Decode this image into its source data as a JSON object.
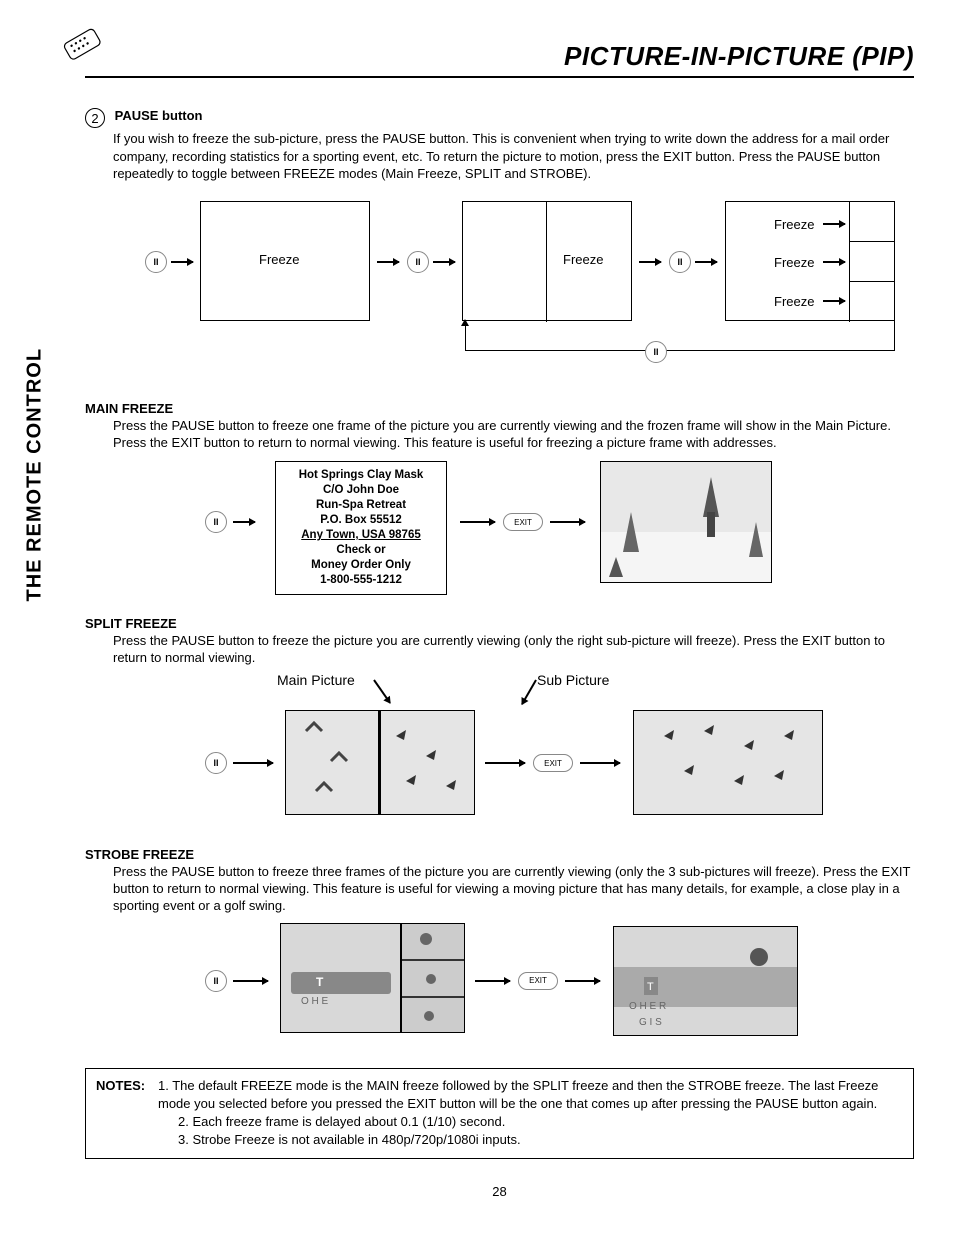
{
  "side_label": "THE REMOTE CONTROL",
  "page_title": "PICTURE-IN-PICTURE (PIP)",
  "step": {
    "num": "2",
    "heading": "PAUSE button",
    "body": "If you wish to freeze the sub-picture, press the PAUSE button. This is convenient when trying to write down the address for a mail order company, recording statistics for a sporting event, etc.  To return the picture to motion, press the EXIT button.  Press the PAUSE button repeatedly to toggle between FREEZE modes (Main Freeze, SPLIT and STROBE)."
  },
  "cycle_labels": {
    "freeze": "Freeze"
  },
  "main_freeze": {
    "heading": "MAIN FREEZE",
    "body": "Press the PAUSE button to freeze one frame of the picture you are currently viewing and the frozen frame will show in the Main Picture.  Press the EXIT button to return to normal viewing.  This feature is useful for freezing a picture frame with addresses.",
    "address_lines": [
      "Hot Springs Clay Mask",
      "C/O John Doe",
      "Run-Spa Retreat",
      "P.O. Box 55512",
      "Any Town, USA 98765",
      "Check or",
      "Money Order Only",
      "1-800-555-1212"
    ]
  },
  "split_freeze": {
    "heading": "SPLIT FREEZE",
    "body": "Press the PAUSE button to freeze the picture you are currently viewing (only the right sub-picture will freeze).  Press the EXIT button to return to normal viewing.",
    "label_main": "Main Picture",
    "label_sub": "Sub Picture"
  },
  "strobe_freeze": {
    "heading": "STROBE FREEZE",
    "body": "Press the PAUSE button to freeze three frames of the picture you are currently viewing (only the 3 sub-pictures will freeze). Press the EXIT button to return to normal viewing. This feature is useful for viewing a moving picture that has many details, for example, a close play in a sporting event or a golf swing."
  },
  "exit_label": "EXIT",
  "notes": {
    "label": "NOTES:",
    "items": [
      "1. The default FREEZE mode is the MAIN freeze followed by the SPLIT freeze and then the STROBE freeze.  The last Freeze mode you selected before you pressed the EXIT button will be the one that comes up after pressing the PAUSE button again.",
      "2. Each freeze frame is delayed about 0.1 (1/10) second.",
      "3. Strobe Freeze is not available in 480p/720p/1080i inputs."
    ]
  },
  "page_number": "28"
}
